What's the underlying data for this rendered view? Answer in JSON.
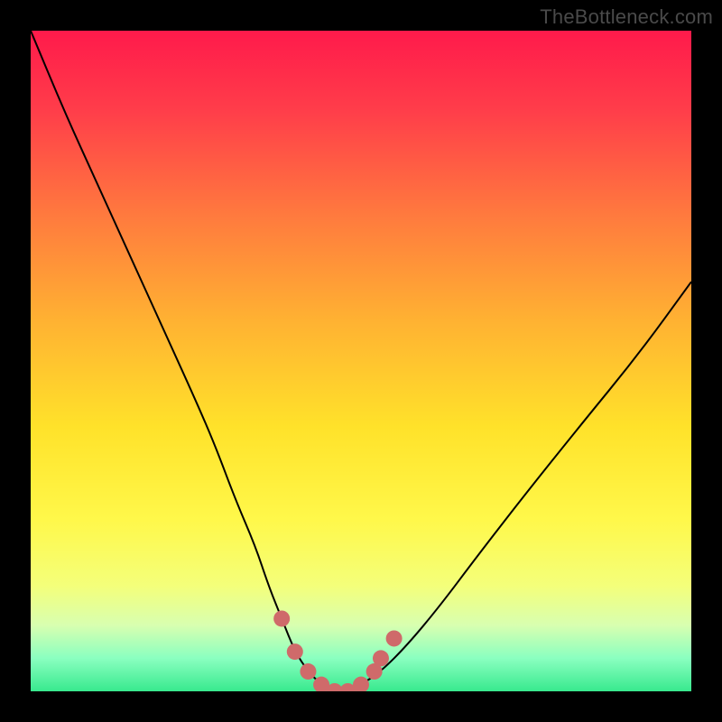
{
  "watermark": "TheBottleneck.com",
  "chart_data": {
    "type": "line",
    "title": "",
    "xlabel": "",
    "ylabel": "",
    "xlim": [
      0,
      100
    ],
    "ylim": [
      0,
      100
    ],
    "grid": false,
    "legend": false,
    "background_gradient_stops": [
      {
        "offset": 0.0,
        "color": "#ff1a4b"
      },
      {
        "offset": 0.12,
        "color": "#ff3d4a"
      },
      {
        "offset": 0.28,
        "color": "#ff7a3e"
      },
      {
        "offset": 0.44,
        "color": "#ffb232"
      },
      {
        "offset": 0.6,
        "color": "#ffe22a"
      },
      {
        "offset": 0.74,
        "color": "#fff84a"
      },
      {
        "offset": 0.84,
        "color": "#f4ff7a"
      },
      {
        "offset": 0.9,
        "color": "#d8ffb0"
      },
      {
        "offset": 0.95,
        "color": "#8affc0"
      },
      {
        "offset": 1.0,
        "color": "#38e98e"
      }
    ],
    "series": [
      {
        "name": "bottleneck-curve",
        "color": "#000000",
        "stroke_width": 2,
        "x": [
          0,
          5,
          10,
          15,
          20,
          25,
          28,
          31,
          34,
          36,
          38,
          40,
          42,
          44,
          46,
          48,
          50,
          53,
          57,
          62,
          68,
          75,
          83,
          92,
          100
        ],
        "y": [
          100,
          88,
          77,
          66,
          55,
          44,
          37,
          29,
          22,
          16,
          11,
          6,
          3,
          1,
          0,
          0,
          1,
          3,
          7,
          13,
          21,
          30,
          40,
          51,
          62
        ]
      }
    ],
    "markers": {
      "name": "trough-markers",
      "color": "#cf6a6a",
      "radius": 9,
      "points": [
        {
          "x": 38,
          "y": 11
        },
        {
          "x": 40,
          "y": 6
        },
        {
          "x": 42,
          "y": 3
        },
        {
          "x": 44,
          "y": 1
        },
        {
          "x": 46,
          "y": 0
        },
        {
          "x": 48,
          "y": 0
        },
        {
          "x": 50,
          "y": 1
        },
        {
          "x": 52,
          "y": 3
        },
        {
          "x": 53,
          "y": 5
        },
        {
          "x": 55,
          "y": 8
        }
      ]
    }
  }
}
